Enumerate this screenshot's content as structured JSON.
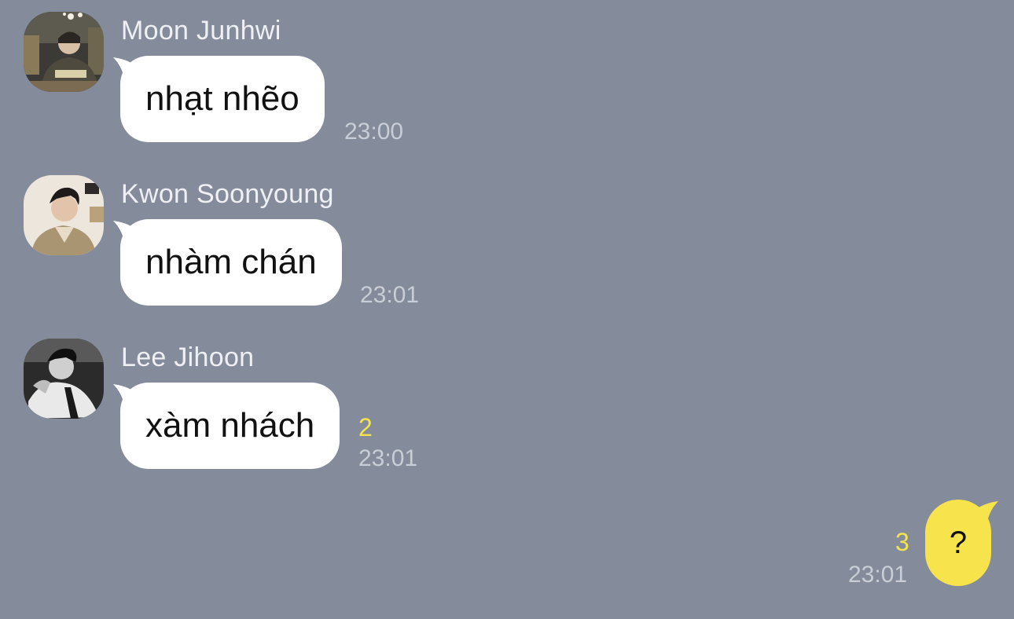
{
  "chat": {
    "background_color": "#848b9b",
    "messages": [
      {
        "sender": "Moon Junhwi",
        "avatar": "profile-photo-moon-junhwi",
        "text": "nhạt nhẽo",
        "time": "23:00",
        "unread": ""
      },
      {
        "sender": "Kwon Soonyoung",
        "avatar": "profile-photo-kwon-soonyoung",
        "text": "nhàm chán",
        "time": "23:01",
        "unread": ""
      },
      {
        "sender": "Lee Jihoon",
        "avatar": "profile-photo-lee-jihoon",
        "text": "xàm nhách",
        "time": "23:01",
        "unread": "2"
      }
    ],
    "my_message": {
      "text": "?",
      "time": "23:01",
      "unread": "3",
      "bubble_color": "#f7e34b"
    }
  }
}
